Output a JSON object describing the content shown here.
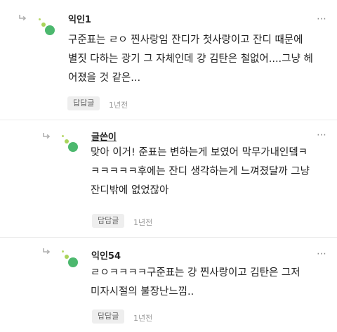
{
  "colors": {
    "avatar_large": "#4cb86e",
    "avatar_medium": "#a9d45a",
    "avatar_small": "#b8d86a",
    "reply_arrow": "#b0b0b0",
    "reply_button_bg": "#eeeeee"
  },
  "icons": {
    "reply_indicator": "reply-arrow-icon",
    "more_menu": "more-dots-icon",
    "avatar": "dot-cluster-avatar"
  },
  "comments": [
    {
      "author": "익인1",
      "author_underlined": false,
      "more_label": "⋯",
      "lines": [
        "구준표는 ㄹㅇ 찐사랑임 잔디가 첫사랑이고 잔디 때문에",
        "별짓 다하는 광기 그 자체인데 걍 김탄은 철없어....그냥 헤",
        "어졌을 것 같은..."
      ],
      "reply_label": "답답글",
      "time": "1년전"
    },
    {
      "author": "글쓴이",
      "author_underlined": true,
      "more_label": "⋯",
      "lines": [
        "맞아 이거! 준표는 변하는게 보였어 막무가내인뎈ㅋ",
        "ㅋㅋㅋㅋㅋ후에는 잔디 생각하는게 느껴졌달까 그냥",
        "잔디밖에 없었잖아"
      ],
      "reply_label": "답답글",
      "time": "1년전"
    },
    {
      "author": "익인54",
      "author_underlined": false,
      "more_label": "⋯",
      "lines": [
        "ㄹㅇㅋㅋㅋㅋ구준표는 걍 찐사랑이고 김탄은 그저",
        "미자시절의 불장난느낌.."
      ],
      "reply_label": "답답글",
      "time": "1년전"
    }
  ]
}
